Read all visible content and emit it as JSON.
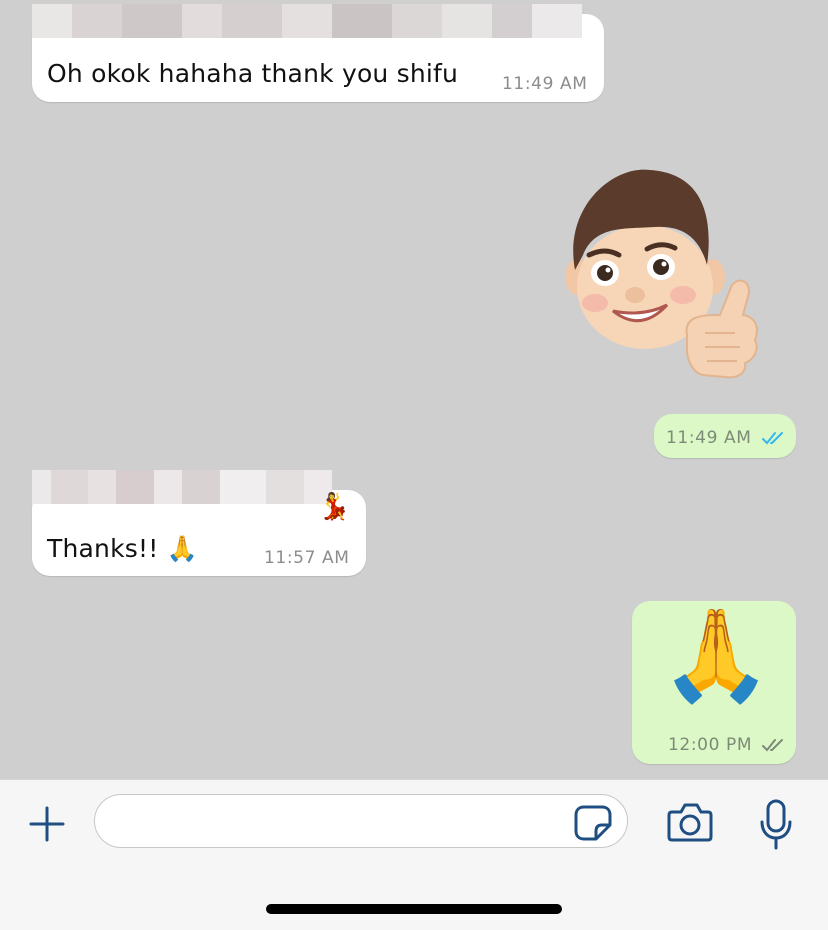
{
  "messages": [
    {
      "direction": "incoming",
      "sender_redacted": true,
      "text": "Oh okok hahaha thank you shifu",
      "time": "11:49 AM"
    },
    {
      "direction": "outgoing",
      "type": "sticker",
      "sticker": "memoji-thumbs-up"
    },
    {
      "direction": "outgoing",
      "text": "",
      "time": "11:49 AM",
      "status": "read"
    },
    {
      "direction": "incoming",
      "sender_redacted": true,
      "text": "Thanks!! 🙏",
      "time": "11:57 AM"
    },
    {
      "direction": "outgoing",
      "type": "emoji",
      "emoji": "🙏",
      "time": "12:00 PM",
      "status": "delivered"
    }
  ],
  "composer": {
    "input_value": "",
    "icons": [
      "plus-icon",
      "sticker-icon",
      "camera-icon",
      "microphone-icon"
    ]
  },
  "colors": {
    "chat_background": "#cfcfcf",
    "incoming_bubble": "#ffffff",
    "outgoing_bubble": "#dcf8c6",
    "read_ticks": "#34b7f1",
    "delivered_ticks": "#8c8c8c",
    "icon_accent": "#1f4f82"
  }
}
